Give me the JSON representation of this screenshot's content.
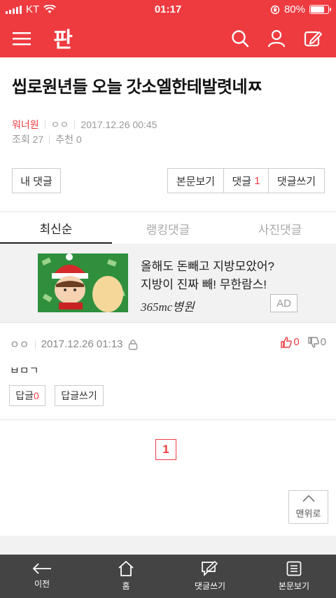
{
  "status_bar": {
    "carrier": "KT",
    "time": "01:17",
    "battery": "80%",
    "battery_level": 0.8
  },
  "header": {
    "logo_text": "판",
    "icons": [
      "menu-icon",
      "search-icon",
      "user-icon",
      "write-icon"
    ]
  },
  "post": {
    "title": "씹로원년들 오늘 갓소엘한테발렷네ㅉ",
    "author": "워너원",
    "nickname": "ㅇㅇ",
    "date": "2017.12.26 00:45",
    "views_label": "조회 27",
    "recommend_label": "추천 0"
  },
  "buttons": {
    "my_comments": "내 댓글",
    "view_post": "본문보기",
    "comments_label": "댓글",
    "comments_count": "1",
    "write_comment": "댓글쓰기"
  },
  "tabs": [
    {
      "label": "최신순",
      "active": true
    },
    {
      "label": "랭킹댓글",
      "active": false
    },
    {
      "label": "사진댓글",
      "active": false
    }
  ],
  "ad": {
    "line1": "올해도 돈빼고 지방모았어?",
    "line2": "지방이 진짜 빼! 무한람스!",
    "brand": "365mc병원",
    "tag": "AD"
  },
  "comment": {
    "author": "ㅇㅇ",
    "date": "2017.12.26 01:13",
    "body": "ㅂㅁㄱ",
    "likes": "0",
    "dislikes": "0",
    "reply_label": "답글",
    "reply_count": "0",
    "reply_write": "답글쓰기"
  },
  "pagination": {
    "current": "1"
  },
  "top_button": "맨위로",
  "bottom_nav": [
    {
      "label": "이전",
      "icon": "back-arrow-icon"
    },
    {
      "label": "홈",
      "icon": "home-icon"
    },
    {
      "label": "댓글쓰기",
      "icon": "comment-write-icon"
    },
    {
      "label": "본문보기",
      "icon": "document-icon"
    }
  ],
  "colors": {
    "accent": "#ee3b40",
    "nav_bg": "#444444"
  }
}
